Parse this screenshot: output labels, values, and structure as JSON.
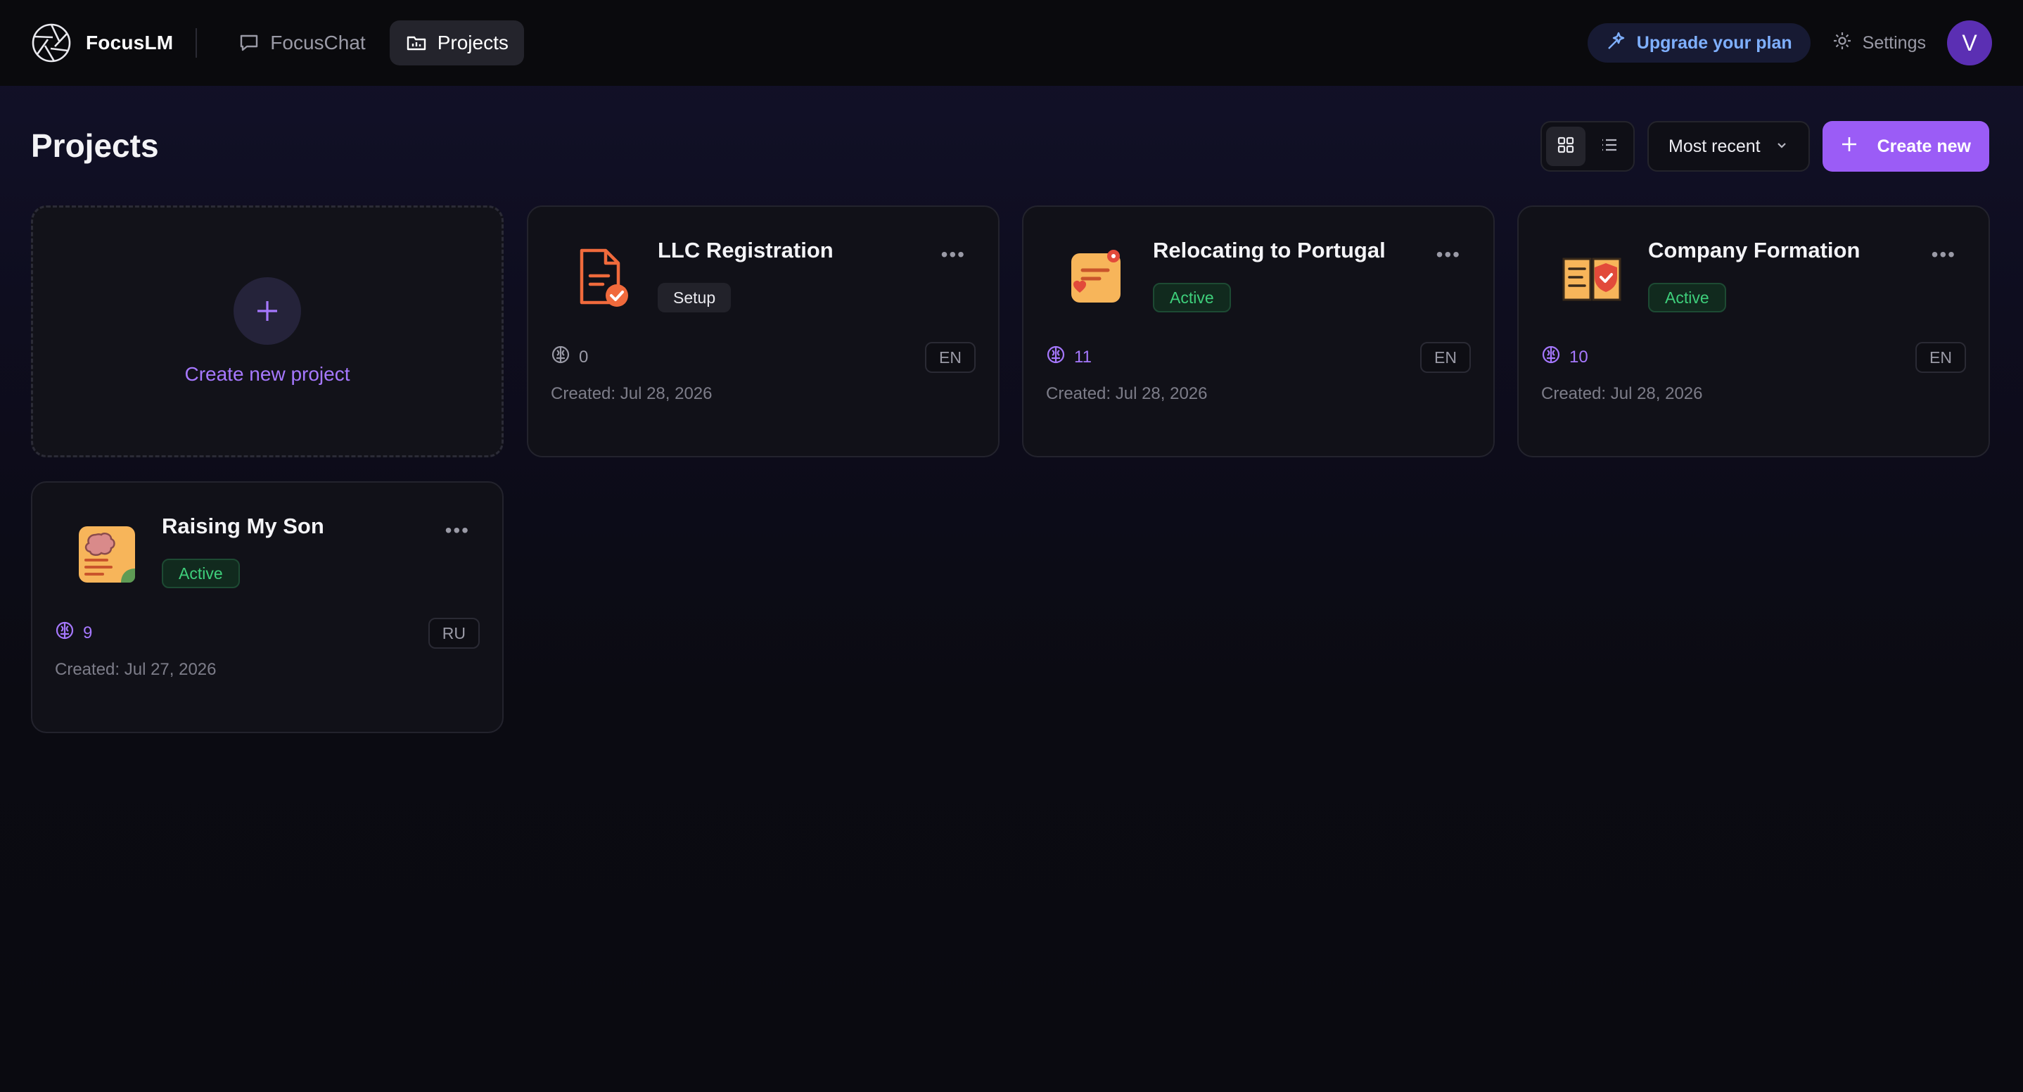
{
  "app": {
    "name": "FocusLM"
  },
  "nav": [
    {
      "label": "FocusChat",
      "icon": "chat-bubble-icon",
      "active": false
    },
    {
      "label": "Projects",
      "icon": "folder-chart-icon",
      "active": true
    }
  ],
  "topbar": {
    "upgrade_label": "Upgrade your plan",
    "settings_label": "Settings",
    "avatar_initial": "V"
  },
  "page": {
    "title": "Projects"
  },
  "controls": {
    "sort_label": "Most recent",
    "create_label": "Create new",
    "view_modes": [
      "grid-view-icon",
      "list-view-icon"
    ]
  },
  "new_project": {
    "label": "Create new project"
  },
  "projects": [
    {
      "title": "LLC Registration",
      "status": "Setup",
      "count": "0",
      "lang": "EN",
      "created": "Created: Jul 28, 2026",
      "icon": "document-check-icon"
    },
    {
      "title": "Relocating to Portugal",
      "status": "Active",
      "count": "11",
      "lang": "EN",
      "created": "Created: Jul 28, 2026",
      "icon": "map-heart-icon"
    },
    {
      "title": "Company Formation",
      "status": "Active",
      "count": "10",
      "lang": "EN",
      "created": "Created: Jul 28, 2026",
      "icon": "book-shield-icon"
    },
    {
      "title": "Raising My Son",
      "status": "Active",
      "count": "9",
      "lang": "RU",
      "created": "Created: Jul 27, 2026",
      "icon": "brain-note-icon"
    }
  ],
  "colors": {
    "accent": "#9b5cf6",
    "upgrade_text": "#7fb0ff",
    "active_badge": "#3ecf7b",
    "background": "#0b0b12"
  }
}
